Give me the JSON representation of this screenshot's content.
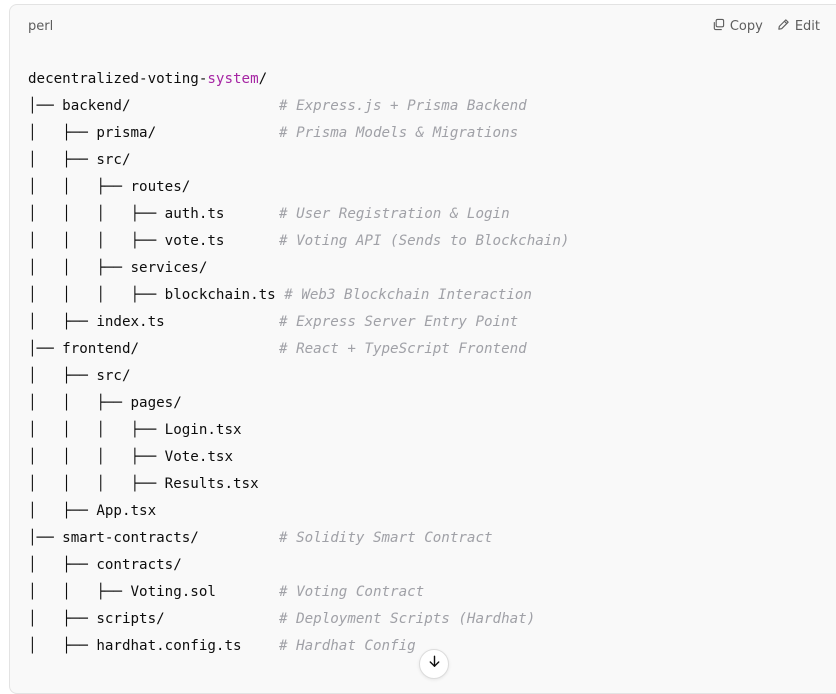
{
  "header": {
    "language": "perl",
    "copy_label": "Copy",
    "edit_label": "Edit",
    "copy_icon": "copy-icon",
    "edit_icon": "pencil-icon"
  },
  "code": {
    "root_prefix": "decentralized-voting-",
    "root_keyword": "system",
    "root_suffix": "/",
    "lines": [
      {
        "tree": "│── backend/",
        "comment": "# Express.js + Prisma Backend"
      },
      {
        "tree": "│   ├── prisma/",
        "comment": "# Prisma Models & Migrations"
      },
      {
        "tree": "│   ├── src/",
        "comment": ""
      },
      {
        "tree": "│   │   ├── routes/",
        "comment": ""
      },
      {
        "tree": "│   │   │   ├── auth.ts",
        "comment": "# User Registration & Login"
      },
      {
        "tree": "│   │   │   ├── vote.ts",
        "comment": "# Voting API (Sends to Blockchain)"
      },
      {
        "tree": "│   │   ├── services/",
        "comment": ""
      },
      {
        "tree": "│   │   │   ├── blockchain.ts",
        "comment": "# Web3 Blockchain Interaction",
        "inline": true
      },
      {
        "tree": "│   ├── index.ts",
        "comment": "# Express Server Entry Point"
      },
      {
        "tree": "│── frontend/",
        "comment": "# React + TypeScript Frontend"
      },
      {
        "tree": "│   ├── src/",
        "comment": ""
      },
      {
        "tree": "│   │   ├── pages/",
        "comment": ""
      },
      {
        "tree": "│   │   │   ├── Login.tsx",
        "comment": ""
      },
      {
        "tree": "│   │   │   ├── Vote.tsx",
        "comment": ""
      },
      {
        "tree": "│   │   │   ├── Results.tsx",
        "comment": ""
      },
      {
        "tree": "│   ├── App.tsx",
        "comment": ""
      },
      {
        "tree": "│── smart-contracts/",
        "comment": "# Solidity Smart Contract"
      },
      {
        "tree": "│   ├── contracts/",
        "comment": ""
      },
      {
        "tree": "│   │   ├── Voting.sol",
        "comment": "# Voting Contract"
      },
      {
        "tree": "│   ├── scripts/",
        "comment": "# Deployment Scripts (Hardhat)"
      },
      {
        "tree": "│   ├── hardhat.config.ts",
        "comment": "# Hardhat Config"
      }
    ]
  },
  "scroll_icon": "arrow-down-icon",
  "colors": {
    "background": "#f9f9f9",
    "keyword": "#a626a4",
    "comment": "#a0a1a7",
    "text": "#0d0d0d"
  }
}
